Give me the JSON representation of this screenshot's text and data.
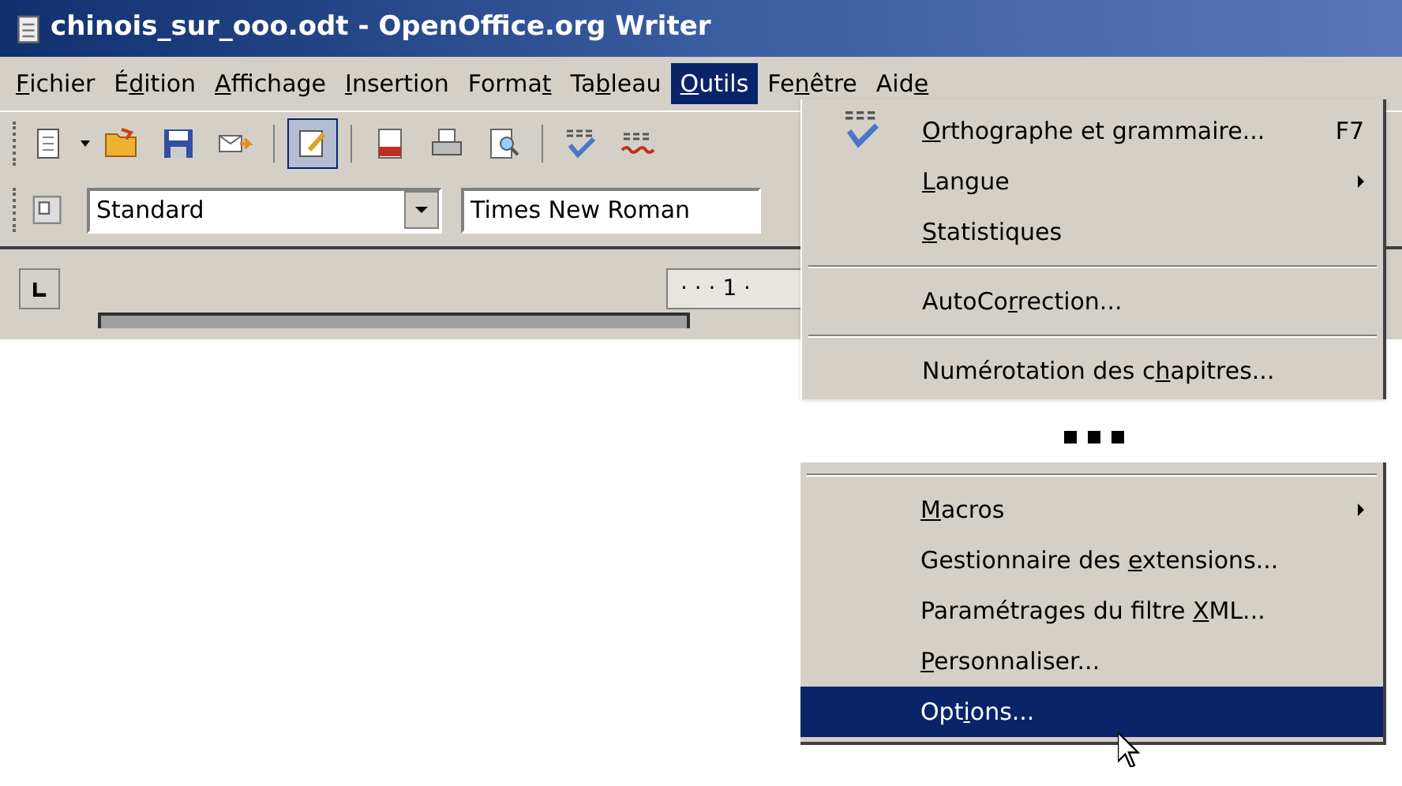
{
  "window": {
    "title": "chinois_sur_ooo.odt - OpenOffice.org Writer"
  },
  "menubar": [
    {
      "key": "F",
      "after": "ichier",
      "selected": false
    },
    {
      "before": "É",
      "key": "d",
      "after": "ition",
      "selected": false
    },
    {
      "key": "A",
      "after": "ffichage",
      "selected": false
    },
    {
      "key": "I",
      "after": "nsertion",
      "selected": false
    },
    {
      "before": "Forma",
      "key": "t",
      "selected": false
    },
    {
      "before": "Ta",
      "key": "b",
      "after": "leau",
      "selected": false
    },
    {
      "key": "O",
      "after": "utils",
      "selected": true
    },
    {
      "before": "Fe",
      "key": "n",
      "after": "être",
      "selected": false
    },
    {
      "before": "Aid",
      "key": "e",
      "selected": false
    }
  ],
  "format_bar": {
    "style": "Standard",
    "font": "Times New Roman"
  },
  "ruler": {
    "mark": "· · · 1 ·"
  },
  "menu_top": [
    {
      "kind": "item",
      "key": "O",
      "after": "rthographe et grammaire...",
      "shortcut": "F7",
      "submenu": false,
      "has_icon": true,
      "selected": false
    },
    {
      "kind": "item",
      "key": "L",
      "after": "angue",
      "submenu": true,
      "has_icon": false,
      "selected": false
    },
    {
      "kind": "item",
      "key": "S",
      "after": "tatistiques",
      "submenu": false,
      "has_icon": false,
      "selected": false
    },
    {
      "kind": "separator"
    },
    {
      "kind": "item",
      "before": "AutoCo",
      "key": "r",
      "after": "rection...",
      "submenu": false,
      "has_icon": false,
      "selected": false
    },
    {
      "kind": "separator"
    },
    {
      "kind": "item",
      "before": "Numérotation des c",
      "key": "h",
      "after": "apitres...",
      "submenu": false,
      "has_icon": false,
      "selected": false
    }
  ],
  "menu_bottom": [
    {
      "kind": "separator"
    },
    {
      "kind": "item",
      "key": "M",
      "after": "acros",
      "submenu": true,
      "has_icon": false,
      "selected": false
    },
    {
      "kind": "item",
      "before": "Gestionnaire des ",
      "key": "e",
      "after": "xtensions...",
      "submenu": false,
      "has_icon": false,
      "selected": false
    },
    {
      "kind": "item",
      "before": "Paramétrages du filtre ",
      "key": "X",
      "after": "ML...",
      "submenu": false,
      "has_icon": false,
      "selected": false
    },
    {
      "kind": "item",
      "key": "P",
      "after": "ersonnaliser...",
      "submenu": false,
      "has_icon": false,
      "selected": false
    },
    {
      "kind": "item",
      "before": "Opt",
      "key": "i",
      "after": "ons...",
      "submenu": false,
      "has_icon": false,
      "selected": true
    }
  ]
}
